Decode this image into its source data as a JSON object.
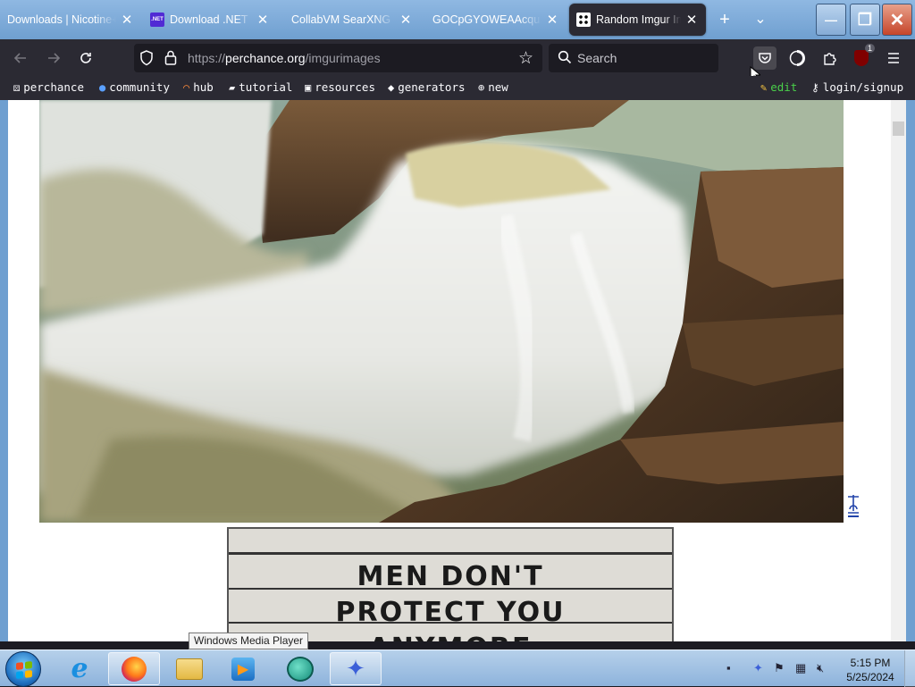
{
  "tabs": [
    {
      "title": "Downloads | Nicotine+",
      "favicon": "nicotine-icon"
    },
    {
      "title": "Download .NET Fra",
      "favicon": "dotnet-icon",
      "favicon_text": ".NET"
    },
    {
      "title": "CollabVM SearXNG",
      "favicon": "searxng-icon"
    },
    {
      "title": "GOCpGYOWEAAcqu.j",
      "favicon": "image-icon"
    },
    {
      "title": "Random Imgur Im",
      "favicon": "perchance-dice-icon",
      "active": true
    }
  ],
  "tab_controls": {
    "new_tab": "+",
    "list_tabs": "⌄"
  },
  "window_controls": {
    "minimize": "—",
    "maximize": "❐",
    "close": "✕"
  },
  "navbar": {
    "url_prefix": "https://",
    "url_host": "perchance.org",
    "url_path": "/imgurimages",
    "search_placeholder": "Search",
    "extension_badge": "1"
  },
  "bookmarks": [
    {
      "label": "perchance",
      "icon": "dice-icon"
    },
    {
      "label": "community",
      "icon": "people-icon"
    },
    {
      "label": "hub",
      "icon": "rainbow-icon"
    },
    {
      "label": "tutorial",
      "icon": "graduation-icon"
    },
    {
      "label": "resources",
      "icon": "box-icon"
    },
    {
      "label": "generators",
      "icon": "tag-icon"
    },
    {
      "label": "new",
      "icon": "plus-circle-icon"
    },
    {
      "label": "edit",
      "icon": "pencil-icon"
    },
    {
      "label": "login/signup",
      "icon": "key-icon"
    }
  ],
  "content": {
    "sign_lines": [
      "MEN DON'T",
      "PROTECT YOU",
      "ANYMORE"
    ]
  },
  "tooltip": "Windows Media Player",
  "taskbar": {
    "apps": [
      "internet-explorer",
      "firefox",
      "file-explorer",
      "windows-media-player",
      "chat-app",
      "bird-app"
    ],
    "time": "5:15 PM",
    "date": "5/25/2024"
  },
  "colors": {
    "tabstrip": "#7aa8d8",
    "toolbar": "#2b2a33",
    "edit_link": "#4ad04a",
    "taskbar": "#9fc0e3"
  }
}
